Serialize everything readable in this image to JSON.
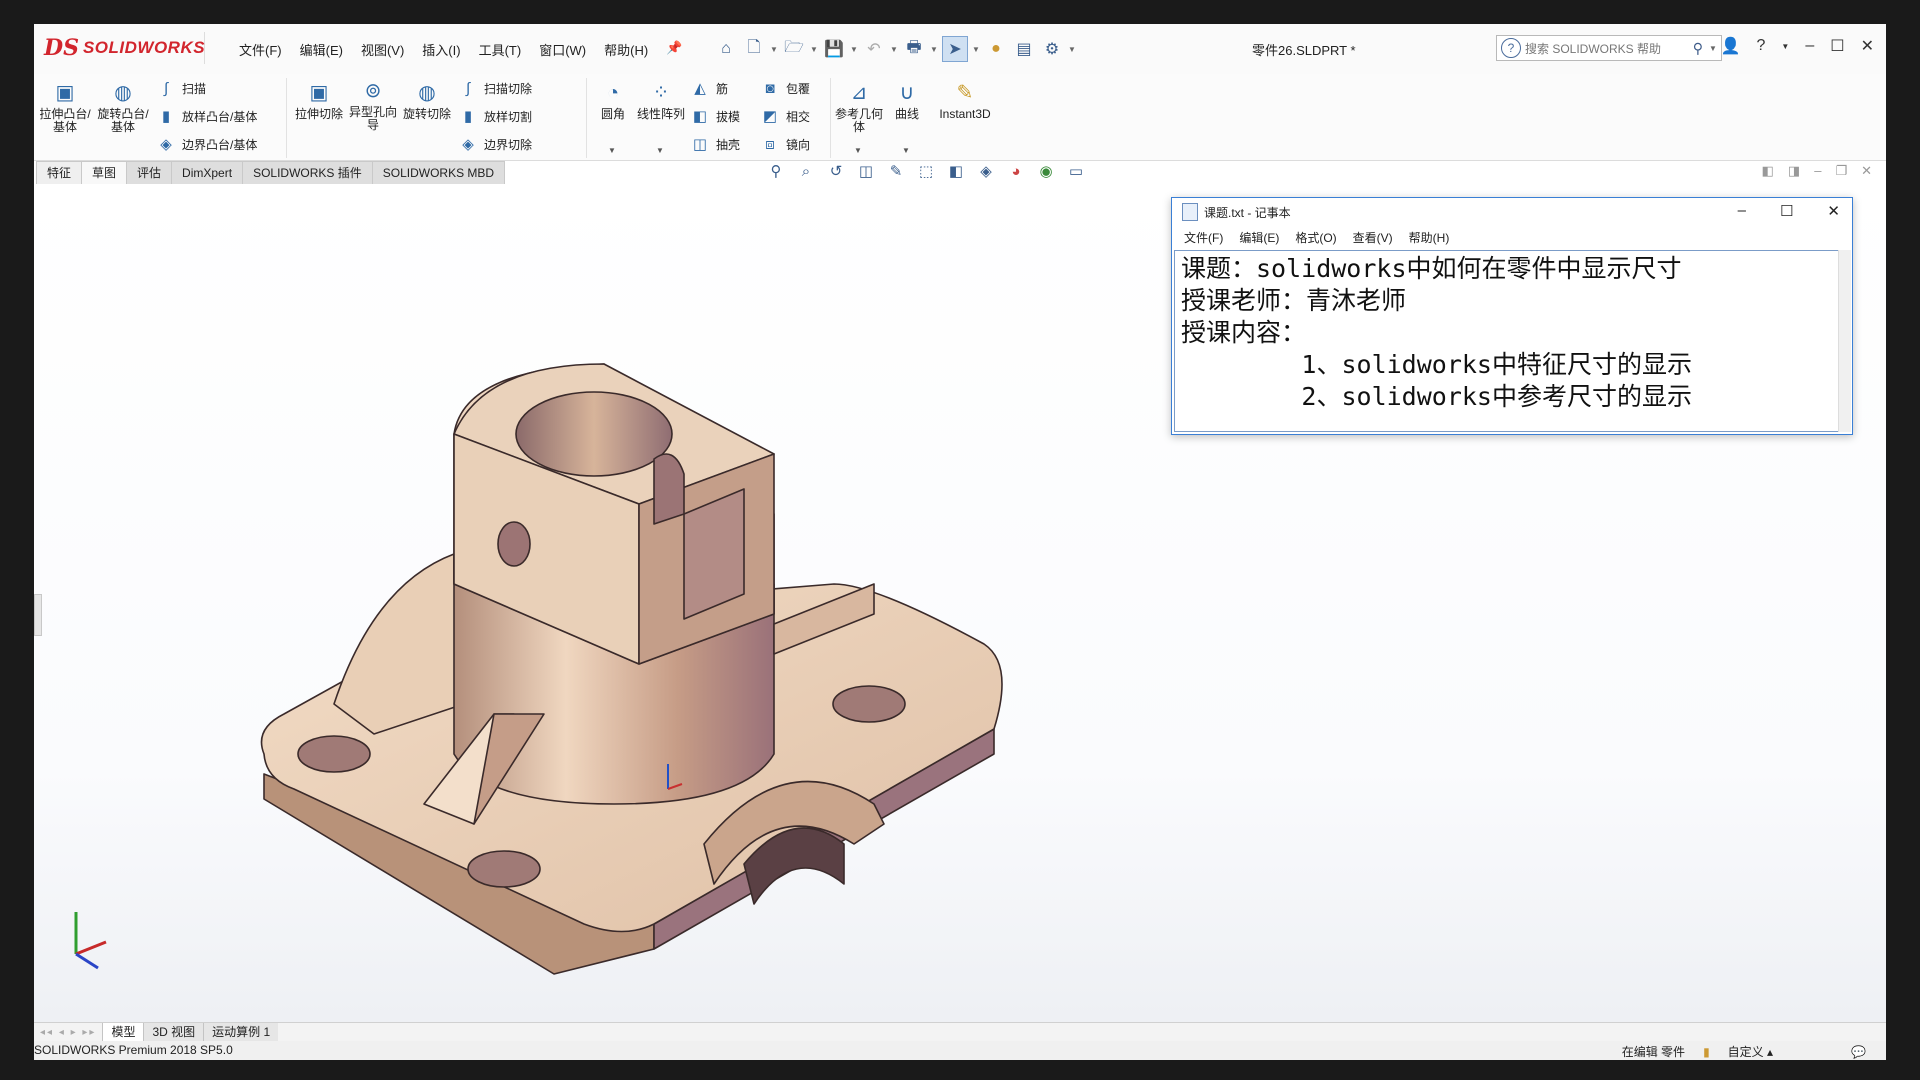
{
  "app": {
    "logo_ds": "DS",
    "logo_text": "SOLIDWORKS",
    "document_title": "零件26.SLDPRT *"
  },
  "menu": [
    "文件(F)",
    "编辑(E)",
    "视图(V)",
    "插入(I)",
    "工具(T)",
    "窗口(W)",
    "帮助(H)"
  ],
  "search": {
    "placeholder": "搜索 SOLIDWORKS 帮助"
  },
  "ribbon": {
    "extrude_boss": "拉伸凸台/基体",
    "revolve_boss": "旋转凸台/基体",
    "sweep": "扫描",
    "loft_boss": "放样凸台/基体",
    "boundary_boss": "边界凸台/基体",
    "extrude_cut": "拉伸切除",
    "hole_wizard": "异型孔向导",
    "revolve_cut": "旋转切除",
    "sweep_cut": "扫描切除",
    "loft_cut": "放样切割",
    "boundary_cut": "边界切除",
    "fillet": "圆角",
    "linear_pattern": "线性阵列",
    "rib": "筋",
    "draft": "拔模",
    "shell": "抽壳",
    "wrap": "包覆",
    "intersect": "相交",
    "mirror": "镜向",
    "ref_geometry": "参考几何体",
    "curves": "曲线",
    "instant3d": "Instant3D"
  },
  "tabs": [
    "特征",
    "草图",
    "评估",
    "DimXpert",
    "SOLIDWORKS 插件",
    "SOLIDWORKS MBD"
  ],
  "notepad": {
    "title": "课题.txt - 记事本",
    "menu": [
      "文件(F)",
      "编辑(E)",
      "格式(O)",
      "查看(V)",
      "帮助(H)"
    ],
    "content": "课题：solidworks中如何在零件中显示尺寸\n授课老师：青沐老师\n授课内容：\n        1、solidworks中特征尺寸的显示\n        2、solidworks中参考尺寸的显示"
  },
  "bottom_tabs": [
    "模型",
    "3D 视图",
    "运动算例 1"
  ],
  "status": {
    "product": "SOLIDWORKS Premium 2018 SP5.0",
    "editing": "在编辑 零件",
    "custom": "自定义"
  },
  "colors": {
    "brand": "#d2252d",
    "model_light": "#e8cdb5",
    "model_mid": "#cfa98f",
    "model_shade": "#a07a82"
  }
}
